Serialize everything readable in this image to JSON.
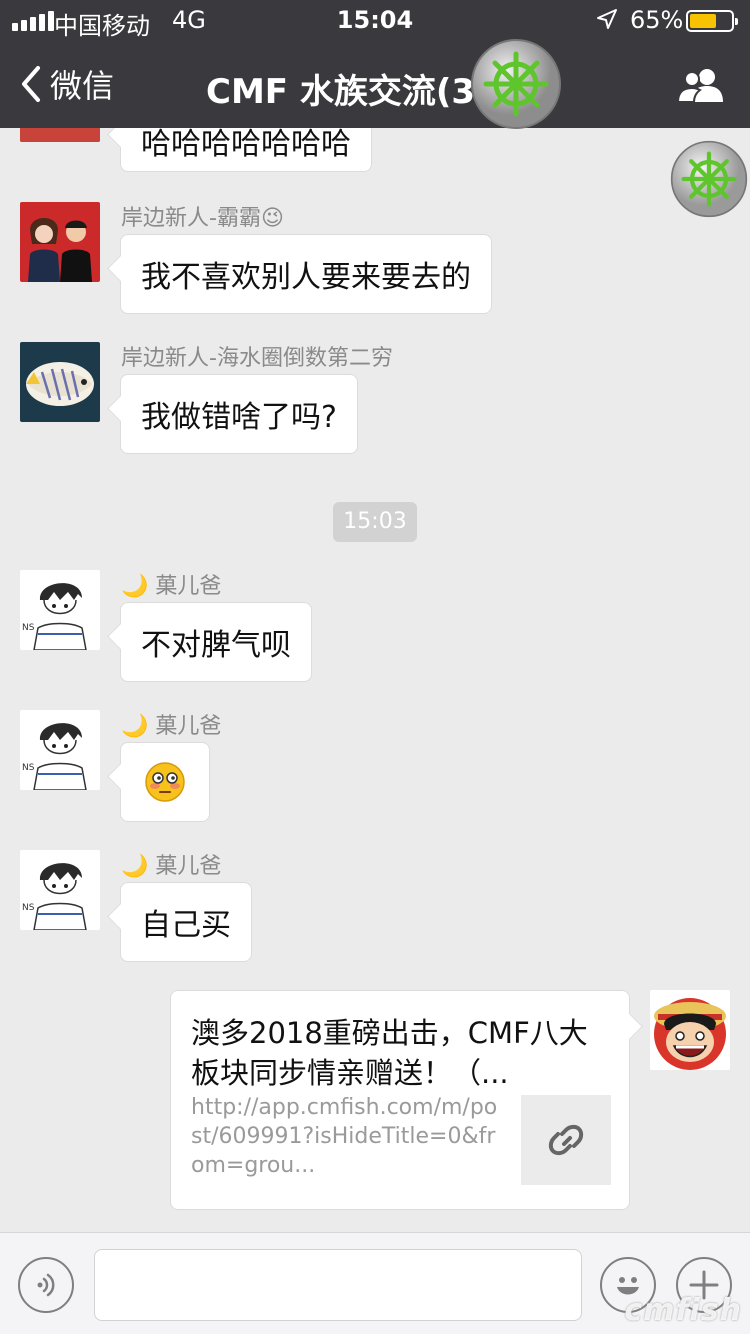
{
  "status": {
    "carrier": "中国移动",
    "network": "4G",
    "time": "15:04",
    "battery": "65%",
    "battery_level": 0.65
  },
  "nav": {
    "back_label": "微信",
    "title": "CMF 水族交流(3"
  },
  "colors": {
    "navbar": "#3a3a3e",
    "chat_bg": "#ebebeb",
    "battery_fill": "#f7c300"
  },
  "messages": [
    {
      "text": "哈哈哈哈哈哈哈"
    },
    {
      "sender": "岸边新人-霸霸😉",
      "text": "我不喜欢别人要来要去的",
      "avatar": "couple-photo"
    },
    {
      "sender": "岸边新人-海水圈倒数第二穷",
      "text": "我做错啥了吗?",
      "avatar": "butterflyfish-photo"
    },
    {
      "sender": "🌙 菓儿爸",
      "text": "不对脾气呗",
      "avatar": "anime-boy"
    },
    {
      "sender": "🌙 菓儿爸",
      "emoji": "😳",
      "avatar": "anime-boy"
    },
    {
      "sender": "🌙 菓儿爸",
      "text": "自己买",
      "avatar": "anime-boy"
    }
  ],
  "time_divider": "15:03",
  "link_card": {
    "title": "澳多2018重磅出击，CMF八大板块同步情亲赠送！（...",
    "url": "http://app.cmfish.com/m/post/609991?isHideTitle=0&from=grou...",
    "icon": "link-icon"
  },
  "self_avatar": "luffy-avatar",
  "input": {
    "placeholder": ""
  },
  "watermark": "cmfish"
}
